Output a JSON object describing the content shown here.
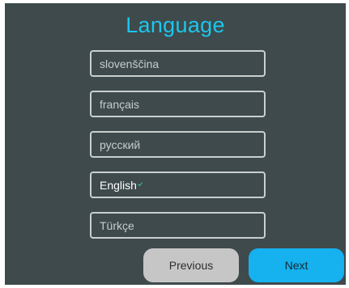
{
  "header": {
    "title": "Language"
  },
  "languages": [
    {
      "label": "slovenščina",
      "selected": false
    },
    {
      "label": "français",
      "selected": false
    },
    {
      "label": "русский",
      "selected": false
    },
    {
      "label": "English",
      "selected": true
    },
    {
      "label": "Türkçe",
      "selected": false
    }
  ],
  "buttons": {
    "previous_label": "Previous",
    "next_label": "Next"
  },
  "colors": {
    "background": "#3e4a4b",
    "accent": "#1cc6ec",
    "next_button": "#16b1ef",
    "previous_button": "#c6c6c6",
    "checkmark": "#3fd3a0"
  },
  "icons": {
    "selected_marker": "check-icon"
  }
}
